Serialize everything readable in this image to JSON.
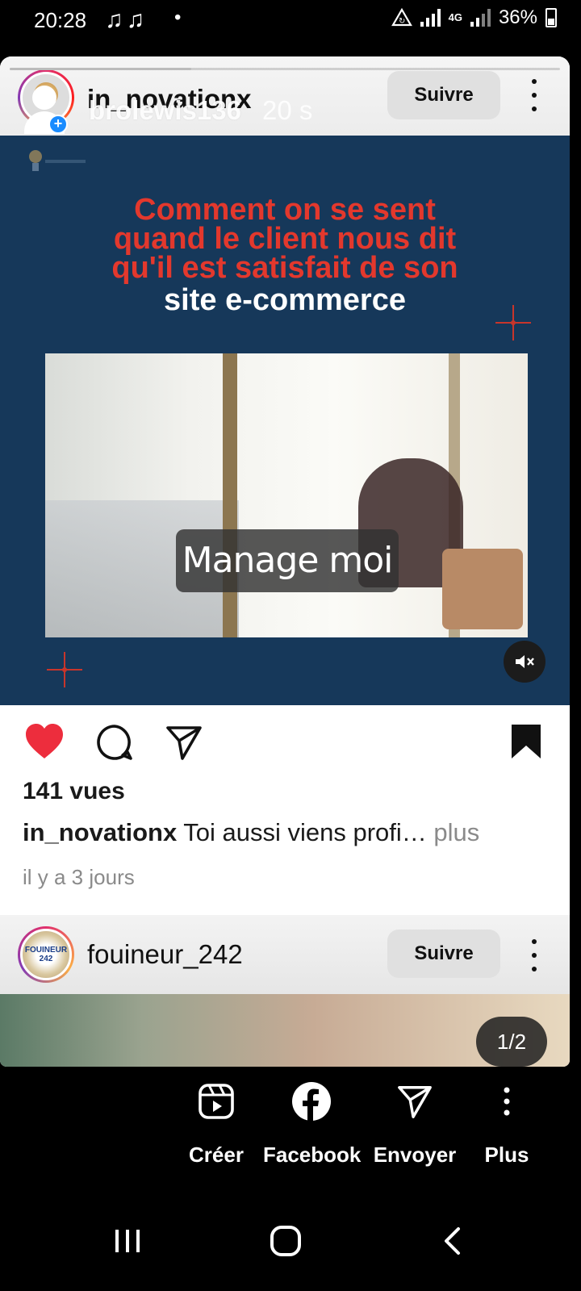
{
  "status_bar": {
    "time": "20:28",
    "notifications": "♫♫",
    "dot": "•",
    "network": "4G",
    "battery": "36%"
  },
  "story": {
    "progress_fraction": 0.33,
    "account": "in_novationx",
    "story_user": "brolewis136",
    "story_time": "20 s",
    "follow_label": "Suivre"
  },
  "media": {
    "headline_red": [
      "Comment on se sent",
      "quand le client  nous dit",
      "qu'il est satisfait de son"
    ],
    "headline_white": "site e-commerce",
    "caption_pill": "Manage moi"
  },
  "post": {
    "views": "141 vues",
    "caption_user": "in_novationx",
    "caption_text": " Toi aussi viens profi… ",
    "caption_more": "plus",
    "time_ago": "il y a 3 jours"
  },
  "post2": {
    "account": "fouineur_242",
    "avatar_text": "FOUINEUR 242",
    "follow_label": "Suivre",
    "pager": "1/2"
  },
  "share_sheet": {
    "items": [
      {
        "label": "Créer",
        "icon": "reels-icon"
      },
      {
        "label": "Facebook",
        "icon": "facebook-icon"
      },
      {
        "label": "Envoyer",
        "icon": "send-icon"
      },
      {
        "label": "Plus",
        "icon": "more-vertical-icon"
      }
    ]
  },
  "colors": {
    "media_bg": "#16385a",
    "headline_red": "#e3382d",
    "like_red": "#ed2d3d",
    "follow_bg": "#e0e0e0"
  }
}
